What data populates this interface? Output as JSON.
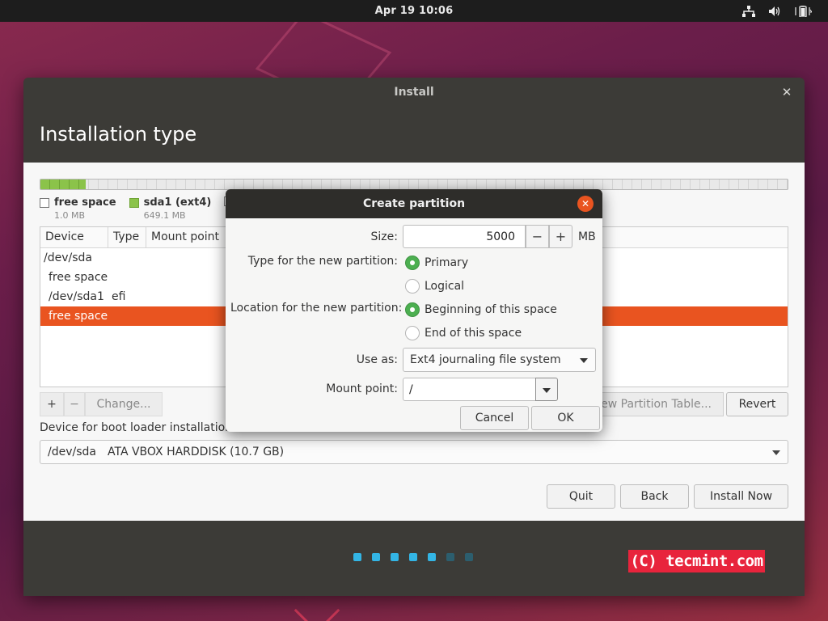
{
  "topbar": {
    "clock": "Apr 19  10:06",
    "tray_icons": [
      "network-icon",
      "volume-icon",
      "battery-icon"
    ]
  },
  "window": {
    "title": "Install",
    "heading": "Installation type"
  },
  "disk_legend": [
    {
      "name": "free space",
      "size": "1.0 MB",
      "color": "#ffffff"
    },
    {
      "name": "sda1 (ext4)",
      "size": "649.1 MB",
      "color": "#8bc34a"
    },
    {
      "name": "",
      "size": "",
      "color": "#ffffff"
    }
  ],
  "partition_table": {
    "columns": [
      "Device",
      "Type",
      "Mount point"
    ],
    "rows": [
      {
        "device": "/dev/sda",
        "type": "",
        "selected": false
      },
      {
        "device": "free space",
        "type": "",
        "selected": false
      },
      {
        "device": "/dev/sda1",
        "type": "efi",
        "selected": false
      },
      {
        "device": "free space",
        "type": "",
        "selected": true
      }
    ]
  },
  "table_tools": {
    "add": "+",
    "remove": "−",
    "change": "Change...",
    "new_table": "New Partition Table...",
    "revert": "Revert"
  },
  "bootloader": {
    "label": "Device for boot loader installation:",
    "device": "/dev/sda",
    "description": "ATA VBOX HARDDISK (10.7 GB)"
  },
  "nav": {
    "quit": "Quit",
    "back": "Back",
    "install_now": "Install Now"
  },
  "progress": {
    "total_steps": 7,
    "completed_steps": 5
  },
  "watermark": "(C) tecmint.com",
  "dialog": {
    "title": "Create partition",
    "size_label": "Size:",
    "size_value": "5000",
    "size_unit": "MB",
    "decrement": "−",
    "increment": "+",
    "type_label": "Type for the new partition:",
    "type_options": [
      {
        "label": "Primary",
        "checked": true
      },
      {
        "label": "Logical",
        "checked": false
      }
    ],
    "location_label": "Location for the new partition:",
    "location_options": [
      {
        "label": "Beginning of this space",
        "checked": true
      },
      {
        "label": "End of this space",
        "checked": false
      }
    ],
    "use_as_label": "Use as:",
    "use_as_value": "Ext4 journaling file system",
    "mount_label": "Mount point:",
    "mount_value": "/",
    "cancel": "Cancel",
    "ok": "OK"
  },
  "colors": {
    "accent": "#e95420",
    "radio_checked": "#4caf50",
    "disk_used": "#8bc34a",
    "progress_dot_on": "#33b5e5",
    "progress_dot_off": "#2c5e6e"
  }
}
